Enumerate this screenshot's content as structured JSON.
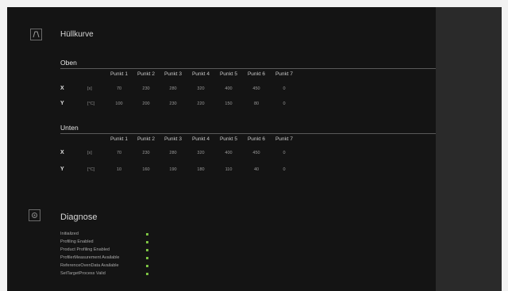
{
  "huellkurve": {
    "title": "Hüllkurve",
    "icon": "curve-icon",
    "oben": {
      "title": "Oben",
      "headers": [
        "Punkt 1",
        "Punkt 2",
        "Punkt 3",
        "Punkt 4",
        "Punkt 5",
        "Punkt 6",
        "Punkt 7"
      ],
      "rows": [
        {
          "label": "X",
          "unit": "[s]",
          "values": [
            "70",
            "230",
            "280",
            "320",
            "400",
            "450",
            "0"
          ]
        },
        {
          "label": "Y",
          "unit": "[°C]",
          "values": [
            "100",
            "200",
            "230",
            "220",
            "150",
            "80",
            "0"
          ]
        }
      ]
    },
    "unten": {
      "title": "Unten",
      "headers": [
        "Punkt 1",
        "Punkt 2",
        "Punkt 3",
        "Punkt 4",
        "Punkt 5",
        "Punkt 6",
        "Punkt 7"
      ],
      "rows": [
        {
          "label": "X",
          "unit": "[s]",
          "values": [
            "70",
            "230",
            "280",
            "320",
            "400",
            "450",
            "0"
          ]
        },
        {
          "label": "Y",
          "unit": "[°C]",
          "values": [
            "10",
            "160",
            "190",
            "180",
            "110",
            "40",
            "0"
          ]
        }
      ]
    }
  },
  "diagnose": {
    "title": "Diagnose",
    "icon": "gear-icon",
    "status_color": "#7cc243",
    "items": [
      {
        "label": "Initialized",
        "status": "ok"
      },
      {
        "label": "Profiling Enabled",
        "status": "ok"
      },
      {
        "label": "Product Profiling Enabled",
        "status": "ok"
      },
      {
        "label": "ProfilerMeasurement Available",
        "status": "ok"
      },
      {
        "label": "ReferenceOvenData Available",
        "status": "ok"
      },
      {
        "label": "SetTargetProcess Valid",
        "status": "ok"
      }
    ]
  }
}
